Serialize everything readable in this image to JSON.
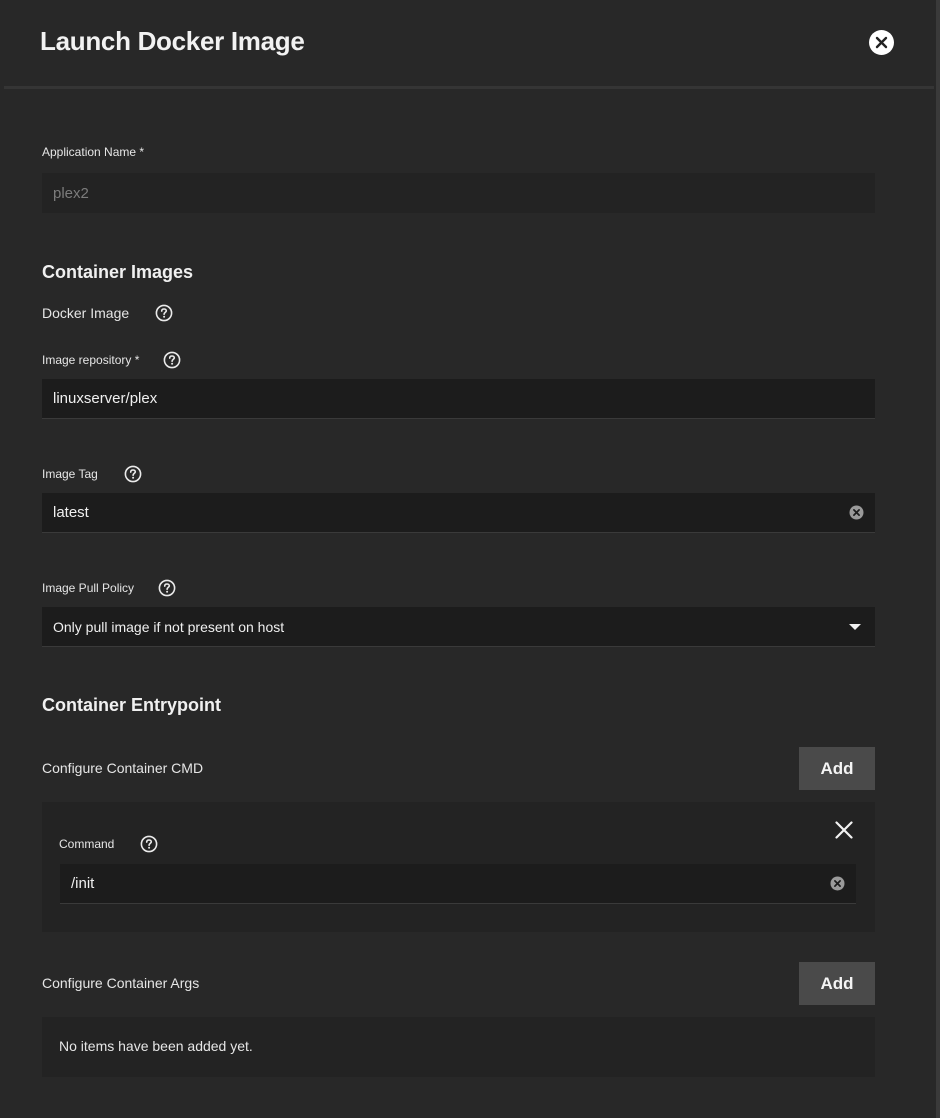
{
  "dialog": {
    "title": "Launch Docker Image",
    "close_icon": "close-circle-icon"
  },
  "app_name": {
    "label": "Application Name *",
    "value": "plex2"
  },
  "container_images": {
    "title": "Container Images",
    "docker_image_label": "Docker Image",
    "repository": {
      "label": "Image repository *",
      "value": "linuxserver/plex"
    },
    "tag": {
      "label": "Image Tag",
      "value": "latest"
    },
    "pull_policy": {
      "label": "Image Pull Policy",
      "value": "Only pull image if not present on host"
    }
  },
  "container_entrypoint": {
    "title": "Container Entrypoint",
    "cmd": {
      "label": "Configure Container CMD",
      "add_label": "Add",
      "items": [
        {
          "label": "Command",
          "value": "/init"
        }
      ]
    },
    "args": {
      "label": "Configure Container Args",
      "add_label": "Add",
      "empty_text": "No items have been added yet."
    }
  },
  "icons": {
    "help": "help-circle-icon",
    "clear": "clear-circle-icon",
    "dropdown": "caret-down-icon",
    "remove": "close-icon"
  },
  "colors": {
    "background": "#282828",
    "field_background": "#1c1c1c",
    "add_button": "#4a4a4a"
  }
}
